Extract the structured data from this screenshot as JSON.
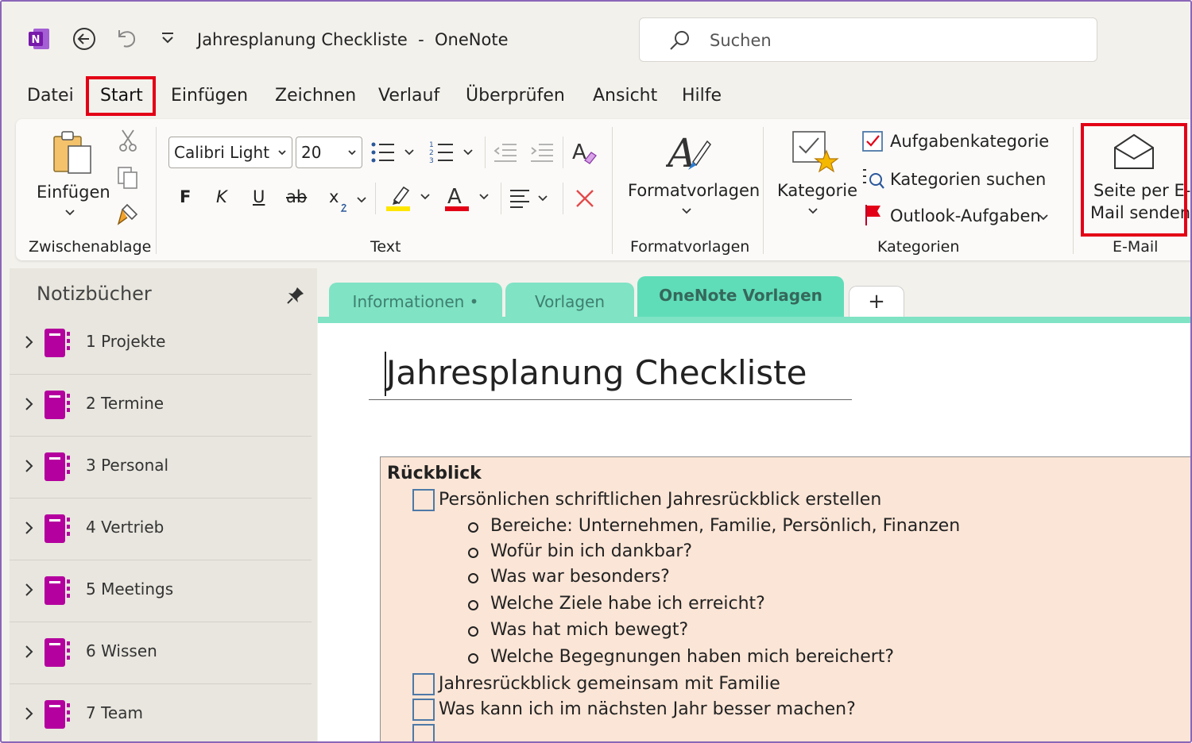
{
  "window": {
    "title": "Jahresplanung Checkliste  -  OneNote",
    "search_placeholder": "Suchen"
  },
  "menu": {
    "items": [
      "Datei",
      "Start",
      "Einfügen",
      "Zeichnen",
      "Verlauf",
      "Überprüfen",
      "Ansicht",
      "Hilfe"
    ],
    "active": "Start"
  },
  "ribbon": {
    "clipboard": {
      "paste_label": "Einfügen",
      "group_label": "Zwischenablage"
    },
    "text": {
      "font_name": "Calibri Light",
      "font_size": "20",
      "bold": "F",
      "italic": "K",
      "underline": "U",
      "strike": "ab",
      "subscript": "x",
      "group_label": "Text",
      "highlight_color": "#ffe600",
      "font_color": "#e30016"
    },
    "styles": {
      "button_label": "Formatvorlagen",
      "group_label": "Formatvorlagen"
    },
    "tags": {
      "button_label": "Kategorie",
      "task_tag": "Aufgabenkategorie",
      "find_tags": "Kategorien suchen",
      "outlook_tasks": "Outlook-Aufgaben",
      "group_label": "Kategorien"
    },
    "email": {
      "button_line1": "Seite per E-",
      "button_line2": "Mail senden",
      "group_label": "E-Mail"
    }
  },
  "notebooks": {
    "header": "Notizbücher",
    "items": [
      "1 Projekte",
      "2 Termine",
      "3 Personal",
      "4 Vertrieb",
      "5 Meetings",
      "6 Wissen",
      "7 Team"
    ],
    "book_color": "#b4009e"
  },
  "sections": {
    "tabs": [
      "Informationen •",
      "Vorlagen",
      "OneNote Vorlagen"
    ],
    "active": "OneNote Vorlagen",
    "add_label": "+",
    "tab_color": "#7fe3c4"
  },
  "page": {
    "title": "Jahresplanung Checkliste",
    "heading": "Rückblick",
    "task1": "Persönlichen schriftlichen Jahresrückblick erstellen",
    "bullets": [
      "Bereiche: Unternehmen, Familie, Persönlich, Finanzen",
      "Wofür bin ich dankbar?",
      "Was war besonders?",
      "Welche Ziele habe ich erreicht?",
      "Was hat mich bewegt?",
      "Welche Begegnungen haben mich bereichert?"
    ],
    "task2": "Jahresrückblick gemeinsam mit Familie",
    "task3": "Was kann ich im nächsten Jahr besser machen?",
    "task4": "",
    "outline_bg": "#fbe5d6"
  }
}
